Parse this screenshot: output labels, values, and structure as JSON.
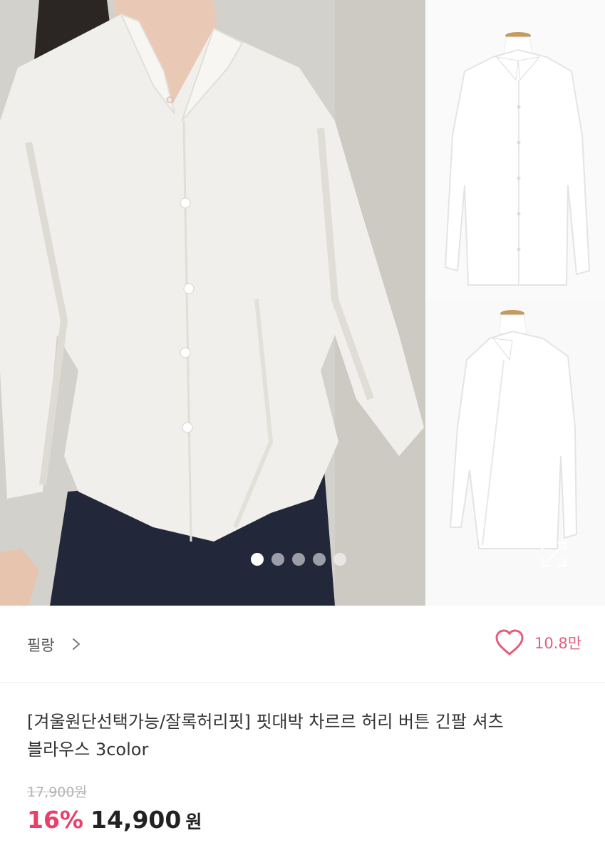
{
  "gallery": {
    "dots": [
      {
        "active": true
      },
      {
        "active": false
      },
      {
        "active": false
      },
      {
        "active": false
      },
      {
        "active": false
      }
    ],
    "icons": [
      "expand-icon"
    ]
  },
  "shop": {
    "name": "필랑",
    "icon": "chevron-right-icon"
  },
  "like": {
    "icon": "heart-icon",
    "count": "10.8만",
    "color": "#e45e7b"
  },
  "product": {
    "title_line1": "[겨울원단선택가능/잘록허리핏] 핏대박 차르르 허리 버튼 긴팔 셔츠",
    "title_line2": "블라우스 3color",
    "original_price": "17,900원",
    "discount": "16%",
    "price": "14,900",
    "currency": "원",
    "discount_color": "#ea3f6b"
  }
}
